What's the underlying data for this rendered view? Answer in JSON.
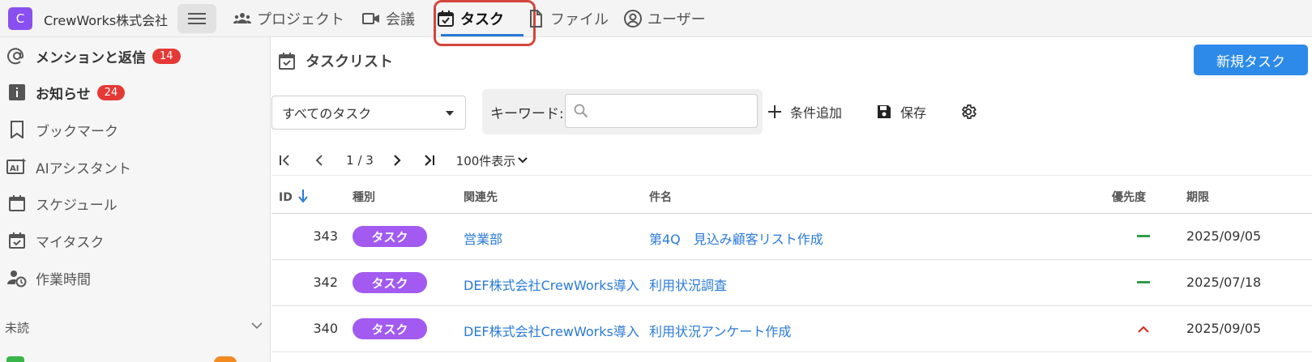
{
  "app": {
    "org_initial": "C",
    "org_name": "CrewWorks株式会社"
  },
  "nav": {
    "items": [
      {
        "label": "プロジェクト",
        "icon": "group-icon"
      },
      {
        "label": "会議",
        "icon": "video-icon"
      },
      {
        "label": "タスク",
        "icon": "calendar-check-icon",
        "active": true
      },
      {
        "label": "ファイル",
        "icon": "file-icon"
      },
      {
        "label": "ユーザー",
        "icon": "user-circle-icon"
      }
    ]
  },
  "sidebar": {
    "items": [
      {
        "label": "メンションと返信",
        "badge": "14",
        "icon": "at-icon"
      },
      {
        "label": "お知らせ",
        "badge": "24",
        "icon": "info-icon"
      },
      {
        "label": "ブックマーク",
        "icon": "bookmark-icon"
      },
      {
        "label": "AIアシスタント",
        "icon": "ai-icon"
      },
      {
        "label": "スケジュール",
        "icon": "calendar-icon"
      },
      {
        "label": "マイタスク",
        "icon": "calendar-check-icon"
      },
      {
        "label": "作業時間",
        "icon": "user-clock-icon"
      }
    ],
    "unread_header": "未読"
  },
  "main": {
    "title": "タスクリスト",
    "new_task_label": "新規タスク",
    "filter": {
      "selected": "すべてのタスク",
      "keyword_label": "キーワード:",
      "keyword_value": ""
    },
    "toolbar": {
      "add_condition": "条件追加",
      "save": "保存"
    },
    "pager": {
      "page_text": "1 / 3",
      "per_page": "100件表示"
    },
    "table": {
      "columns": {
        "id": "ID",
        "type": "種別",
        "related": "関連先",
        "subject": "件名",
        "priority": "優先度",
        "due": "期限"
      },
      "rows": [
        {
          "id": "343",
          "type": "タスク",
          "related": "営業部",
          "subject": "第4Q　見込み顧客リスト作成",
          "priority": "normal",
          "due": "2025/09/05"
        },
        {
          "id": "342",
          "type": "タスク",
          "related": "DEF株式会社CrewWorks導入",
          "subject": "利用状況調査",
          "priority": "normal",
          "due": "2025/07/18"
        },
        {
          "id": "340",
          "type": "タスク",
          "related": "DEF株式会社CrewWorks導入",
          "subject": "利用状況アンケート作成",
          "priority": "high",
          "due": "2025/09/05"
        }
      ]
    }
  },
  "colors": {
    "accent": "#2d8ae8",
    "type_pill": "#a25af0",
    "badge": "#e53935",
    "prio_normal": "#2e9e4a",
    "prio_high": "#d4312b",
    "highlight": "#d4453b"
  }
}
